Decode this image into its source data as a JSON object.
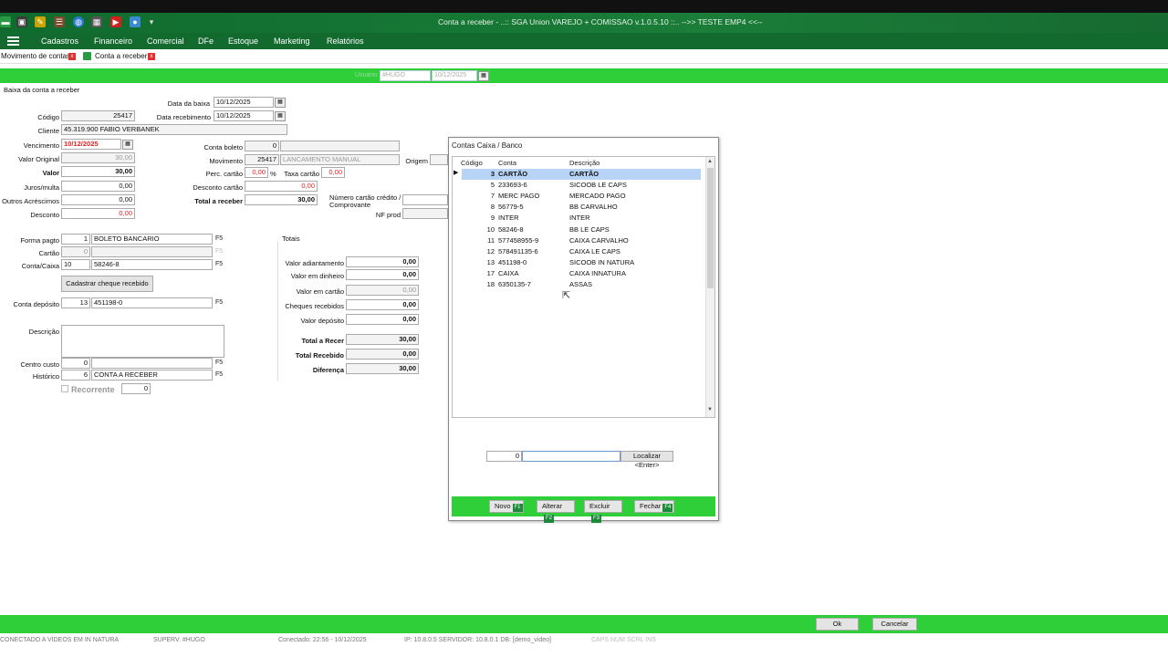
{
  "window": {
    "title": "Conta a receber - ..:: SGA Union VAREJO + COMISSAO v.1.0.5.10 ::.. -->> TESTE EMP4 <<--"
  },
  "menu": [
    "Cadastros",
    "Financeiro",
    "Comercial",
    "DFe",
    "Estoque",
    "Marketing",
    "Relatórios"
  ],
  "tabs": [
    {
      "label": "Movimento de contas"
    },
    {
      "label": "Conta a receber"
    }
  ],
  "topbar": {
    "usuario_label": "Usuário:",
    "usuario_value": "#HUGO",
    "date_value": "10/12/2025"
  },
  "form": {
    "section_title": "Baixa da conta a receber",
    "data_baixa_label": "Data da baixa",
    "data_baixa": "10/12/2025",
    "data_recebimento_label": "Data recebimento",
    "data_recebimento": "10/12/2025",
    "codigo_label": "Código",
    "codigo": "25417",
    "cliente_label": "Cliente",
    "cliente": "45.319.900 FABIO VERBANEK",
    "vencimento_label": "Vencimento",
    "vencimento": "10/12/2025",
    "valor_original_label": "Valor Original",
    "valor_original": "30,00",
    "valor_label": "Valor",
    "valor": "30,00",
    "juros_label": "Juros/multa",
    "juros": "0,00",
    "outros_label": "Outros Acréscimos",
    "outros": "0,00",
    "desconto_label": "Desconto",
    "desconto": "0,00",
    "conta_boleto_label": "Conta boleto",
    "conta_boleto": "0",
    "movimento_label": "Movimento",
    "movimento_code": "25417",
    "movimento_desc": "LANCAMENTO MANUAL",
    "origem_label": "Origem",
    "perc_cartao_label": "Perc. cartão",
    "perc_cartao": "0,00",
    "percent_sign": "%",
    "taxa_cartao_label": "Taxa cartão",
    "taxa_cartao": "0,00",
    "desconto_cartao_label": "Desconto cartão",
    "desconto_cartao": "0,00",
    "total_receber_label": "Total a receber",
    "total_receber": "30,00",
    "numero_cartao_label": "Número cartão crédito / Comprovante",
    "nf_prod_label": "NF prod",
    "forma_pagto_label": "Forma pagto",
    "forma_pagto_code": "1",
    "forma_pagto_desc": "BOLETO BANCARIO",
    "cartao_label": "Cartão",
    "cartao_code": "0",
    "conta_caixa_label": "Conta/Caixa",
    "conta_caixa_code": "10",
    "conta_caixa_desc": "58246-8",
    "cadastrar_cheque": "Cadastrar cheque recebido",
    "conta_deposito_label": "Conta depósito",
    "conta_deposito_code": "13",
    "conta_deposito_desc": "451198-0",
    "descricao_label": "Descrição",
    "centro_custo_label": "Centro custo",
    "centro_custo_code": "0",
    "historico_label": "Histórico",
    "historico_code": "6",
    "historico_desc": "CONTA A RECEBER",
    "recorrente_label": "Recorrente",
    "recorrente_value": "0",
    "f5": "F5"
  },
  "totais": {
    "title": "Totais",
    "valor_adiantamento_label": "Valor adiantamento",
    "valor_adiantamento": "0,00",
    "valor_dinheiro_label": "Valor em dinheiro",
    "valor_dinheiro": "0,00",
    "valor_cartao_label": "Valor em cartão",
    "valor_cartao": "0,00",
    "cheques_label": "Cheques recebidos",
    "cheques": "0,00",
    "valor_deposito_label": "Valor depósito",
    "valor_deposito": "0,00",
    "total_receber_label": "Total a Recer",
    "total_receber": "30,00",
    "total_recebido_label": "Total Recebido",
    "total_recebido": "0,00",
    "diferenca_label": "Diferença",
    "diferenca": "30,00"
  },
  "dialog": {
    "title": "Contas Caixa / Banco",
    "columns": [
      "Código",
      "Conta",
      "Descrição"
    ],
    "rows": [
      {
        "codigo": "3",
        "conta": "CARTÃO",
        "descricao": "CARTÃO"
      },
      {
        "codigo": "5",
        "conta": "233693-6",
        "descricao": "SICOOB LE CAPS"
      },
      {
        "codigo": "7",
        "conta": "MERC PAGO",
        "descricao": "MERCADO PAGO"
      },
      {
        "codigo": "8",
        "conta": "56779-5",
        "descricao": "BB CARVALHO"
      },
      {
        "codigo": "9",
        "conta": "INTER",
        "descricao": "INTER"
      },
      {
        "codigo": "10",
        "conta": "58246-8",
        "descricao": "BB LE CAPS"
      },
      {
        "codigo": "11",
        "conta": "577458955-9",
        "descricao": "CAIXA CARVALHO"
      },
      {
        "codigo": "12",
        "conta": "578491135-6",
        "descricao": "CAIXA LE CAPS"
      },
      {
        "codigo": "13",
        "conta": "451198-0",
        "descricao": "SICOOB IN NATURA"
      },
      {
        "codigo": "17",
        "conta": "CAIXA",
        "descricao": "CAIXA INNATURA"
      },
      {
        "codigo": "18",
        "conta": "6350135-7",
        "descricao": "ASSAS"
      }
    ],
    "search_code": "0",
    "search_value": "",
    "localizar": "Localizar <Enter>",
    "buttons": [
      {
        "label": "Novo",
        "key": "F1"
      },
      {
        "label": "Alterar",
        "key": "F2"
      },
      {
        "label": "Excluir",
        "key": "F3"
      },
      {
        "label": "Fechar",
        "key": "F4"
      }
    ]
  },
  "footer": {
    "ok": "Ok",
    "cancelar": "Cancelar"
  },
  "status": {
    "connected": "CONECTADO A VIDEOS EM IN NATURA",
    "user": "SUPERV. #HUGO",
    "conectado": "Conectado: 22:56 - 10/12/2025",
    "ip": "IP: 10.8.0.5 SERVIDOR: 10.8.0.1 DB: [demo_video]",
    "keys": "CAPS   NUM   SCRL   INS"
  },
  "colors": {
    "title_green": "#136a2f",
    "bar_green": "#2fcf3a",
    "selection": "#b7d3f5",
    "red_text": "#d22222"
  }
}
